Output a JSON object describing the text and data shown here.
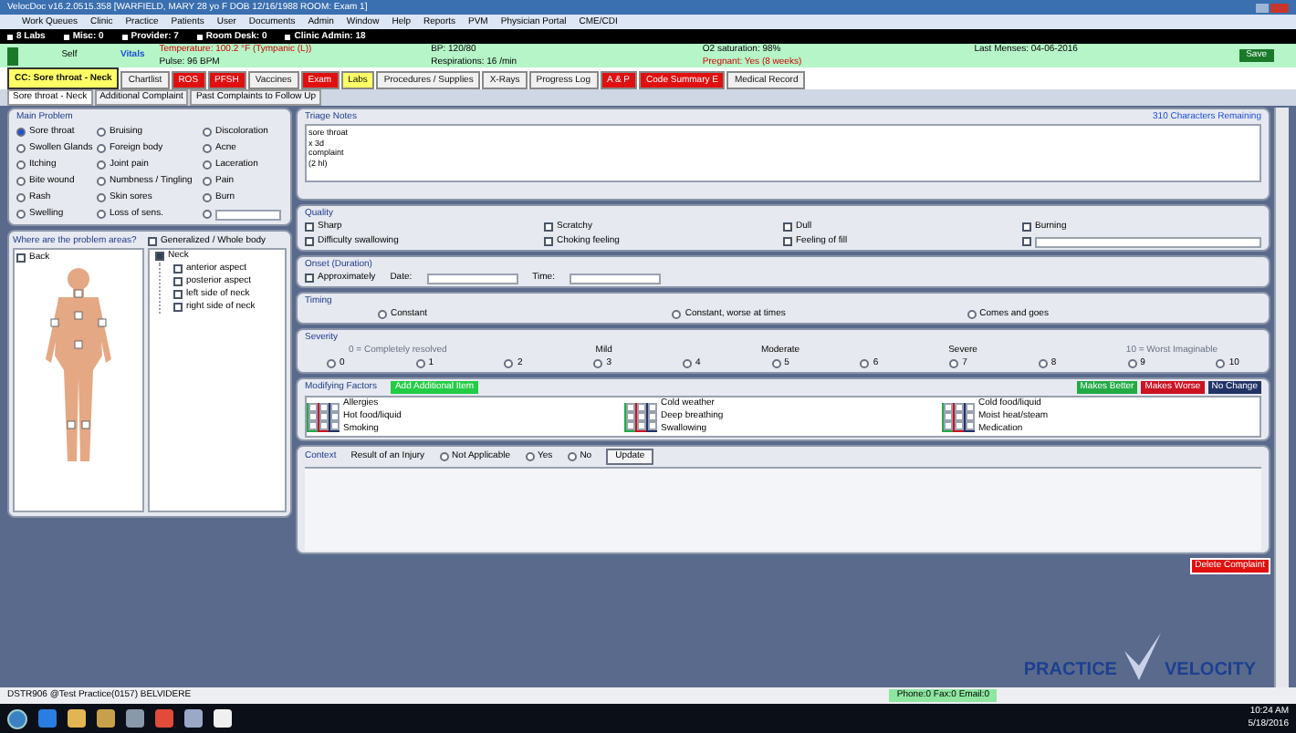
{
  "window": {
    "title": "VelocDoc v16.2.0515.358  [WARFIELD, MARY  28 yo F  DOB 12/16/1988  ROOM: Exam 1]"
  },
  "menu": [
    "Work Queues",
    "Clinic",
    "Practice",
    "Patients",
    "User",
    "Documents",
    "Admin",
    "Window",
    "Help",
    "Reports",
    "PVM",
    "Physician Portal",
    "CME/CDI"
  ],
  "queues": [
    "8 Labs",
    "Misc: 0",
    "Provider: 7",
    "Room Desk: 0",
    "Clinic Admin: 18"
  ],
  "patient": {
    "relation": "Self",
    "vitals_link": "Vitals",
    "vitals": [
      "Temperature: 100.2 °F (Tympanic (L))",
      "BP: 120/80",
      "O2 saturation: 98%",
      "Last Menses: 04-06-2016",
      "Pulse: 96 BPM",
      "Respirations: 16 /min",
      "Pregnant: Yes (8 weeks)"
    ],
    "save": "Save"
  },
  "chart_tabs": [
    {
      "label": "CC: Sore throat - Neck",
      "color": "#ffff66",
      "selected": true
    },
    {
      "label": "Chartlist",
      "color": "#f0f0f0",
      "selected": false
    },
    {
      "label": "ROS",
      "color": "#e01010",
      "selected": false
    },
    {
      "label": "PFSH",
      "color": "#e01010",
      "selected": false
    },
    {
      "label": "Vaccines",
      "color": "#f0f0f0",
      "selected": false
    },
    {
      "label": "Exam",
      "color": "#e01010",
      "selected": false
    },
    {
      "label": "Labs",
      "color": "#ffff66",
      "selected": false
    },
    {
      "label": "Procedures / Supplies",
      "color": "#f0f0f0",
      "selected": false
    },
    {
      "label": "X-Rays",
      "color": "#f0f0f0",
      "selected": false
    },
    {
      "label": "Progress Log",
      "color": "#f0f0f0",
      "selected": false
    },
    {
      "label": "A & P",
      "color": "#e01010",
      "selected": false
    },
    {
      "label": "Code Summary E",
      "color": "#e01010",
      "selected": false
    },
    {
      "label": "Medical Record",
      "color": "#f0f0f0",
      "selected": false
    }
  ],
  "complaint_tabs": [
    {
      "label": "Sore throat - Neck",
      "selected": true
    },
    {
      "label": "Additional Complaint",
      "selected": false
    },
    {
      "label": "Past Complaints to Follow Up",
      "selected": false
    }
  ],
  "main_problem": {
    "title": "Main Problem",
    "options": [
      {
        "label": "Sore throat",
        "selected": true
      },
      {
        "label": "Bruising",
        "selected": false
      },
      {
        "label": "Discoloration",
        "selected": false
      },
      {
        "label": "Swollen Glands",
        "selected": false
      },
      {
        "label": "Foreign body",
        "selected": false
      },
      {
        "label": "Acne",
        "selected": false
      },
      {
        "label": "Itching",
        "selected": false
      },
      {
        "label": "Joint pain",
        "selected": false
      },
      {
        "label": "Laceration",
        "selected": false
      },
      {
        "label": "Bite wound",
        "selected": false
      },
      {
        "label": "Numbness / Tingling",
        "selected": false
      },
      {
        "label": "Pain",
        "selected": false
      },
      {
        "label": "Rash",
        "selected": false
      },
      {
        "label": "Skin sores",
        "selected": false
      },
      {
        "label": "Burn",
        "selected": false
      },
      {
        "label": "Swelling",
        "selected": false
      },
      {
        "label": "Loss of sens.",
        "selected": false
      }
    ],
    "other": {
      "selected": false
    }
  },
  "areas": {
    "title": "Where are the problem areas?",
    "back": {
      "label": "Back",
      "checked": false
    },
    "generalized": {
      "label": "Generalized / Whole body",
      "checked": false
    },
    "tree": [
      {
        "label": "Neck",
        "checked": true,
        "children": [
          {
            "label": "anterior aspect",
            "checked": false
          },
          {
            "label": "posterior aspect",
            "checked": false
          },
          {
            "label": "left side of neck",
            "checked": false
          },
          {
            "label": "right side of neck",
            "checked": false
          }
        ]
      }
    ]
  },
  "triage": {
    "title": "Triage Notes",
    "remaining": "310 Characters Remaining",
    "value": "sore throat\nx 3d\ncomplaint\n(2 hl)"
  },
  "quality": {
    "title": "Quality",
    "options": [
      {
        "label": "Sharp",
        "checked": false
      },
      {
        "label": "Scratchy",
        "checked": false
      },
      {
        "label": "Dull",
        "checked": false
      },
      {
        "label": "Burning",
        "checked": false
      },
      {
        "label": "Difficulty swallowing",
        "checked": false
      },
      {
        "label": "Choking feeling",
        "checked": false
      },
      {
        "label": "Feeling of fill",
        "checked": false
      }
    ],
    "other": {
      "checked": false
    }
  },
  "onset": {
    "title": "Onset (Duration)",
    "approx": {
      "label": "Approximately",
      "checked": false
    },
    "date": "Date:",
    "time": "Time:"
  },
  "timing": {
    "title": "Timing",
    "options": [
      {
        "label": "Constant",
        "selected": false
      },
      {
        "label": "Constant, worse at times",
        "selected": false
      },
      {
        "label": "Comes and goes",
        "selected": false
      }
    ]
  },
  "severity": {
    "title": "Severity",
    "low": "0 = Completely resolved",
    "high": "10 = Worst Imaginable",
    "bands": [
      "Mild",
      "Moderate",
      "Severe"
    ],
    "levels": [
      {
        "label": "0",
        "selected": false
      },
      {
        "label": "1",
        "selected": false
      },
      {
        "label": "2",
        "selected": false
      },
      {
        "label": "3",
        "selected": false
      },
      {
        "label": "4",
        "selected": false
      },
      {
        "label": "5",
        "selected": false
      },
      {
        "label": "6",
        "selected": false
      },
      {
        "label": "7",
        "selected": false
      },
      {
        "label": "8",
        "selected": false
      },
      {
        "label": "9",
        "selected": false
      },
      {
        "label": "10",
        "selected": false
      }
    ]
  },
  "modifying": {
    "title": "Modifying Factors",
    "add": "Add Additional Item",
    "legend": [
      {
        "label": "Makes Better",
        "color": "#22aa44"
      },
      {
        "label": "Makes Worse",
        "color": "#cc1122"
      },
      {
        "label": "No Change",
        "color": "#223366"
      }
    ],
    "items": [
      {
        "label": "Allergies",
        "checks": [
          false,
          false,
          false
        ]
      },
      {
        "label": "Hot food/liquid",
        "checks": [
          false,
          false,
          false
        ]
      },
      {
        "label": "Smoking",
        "checks": [
          false,
          false,
          false
        ]
      },
      {
        "label": "Cold weather",
        "checks": [
          false,
          false,
          false
        ]
      },
      {
        "label": "Deep breathing",
        "checks": [
          false,
          false,
          false
        ]
      },
      {
        "label": "Swallowing",
        "checks": [
          false,
          false,
          false
        ]
      },
      {
        "label": "Cold food/liquid",
        "checks": [
          false,
          false,
          false
        ]
      },
      {
        "label": "Moist heat/steam",
        "checks": [
          false,
          false,
          false
        ]
      },
      {
        "label": "Medication",
        "checks": [
          false,
          false,
          false
        ]
      }
    ]
  },
  "context": {
    "title": "Context",
    "question": "Result of an Injury",
    "options": [
      {
        "label": "Not Applicable",
        "selected": false
      },
      {
        "label": "Yes",
        "selected": false
      },
      {
        "label": "No",
        "selected": false
      }
    ],
    "update": "Update"
  },
  "delete": "Delete Complaint",
  "logo": {
    "left": "PRACTICE",
    "right": "VELOCITY"
  },
  "status": {
    "left": "DSTR906  @Test Practice(0157)  BELVIDERE",
    "messages": "Phone:0 Fax:0 Email:0"
  },
  "clock": {
    "time": "10:24 AM",
    "date": "5/18/2016"
  }
}
